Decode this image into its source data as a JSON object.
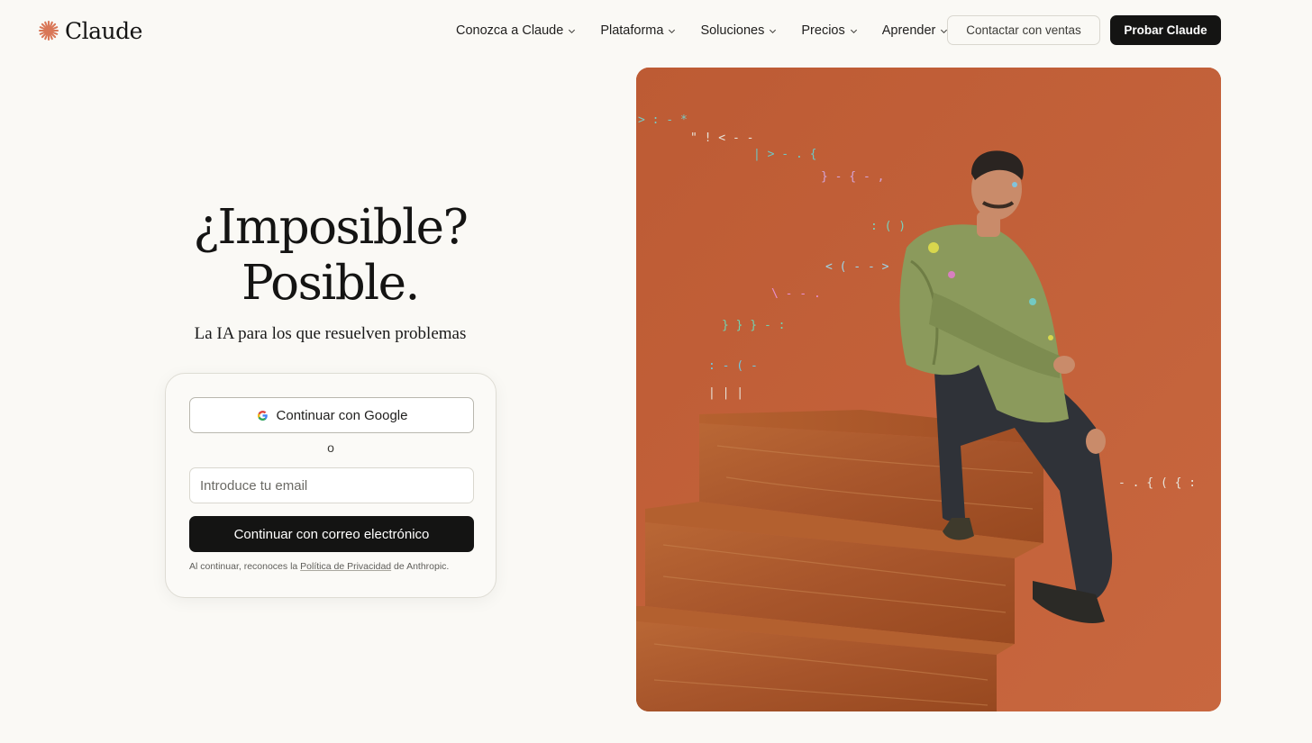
{
  "brand": {
    "name": "Claude",
    "accent_color": "#d97757"
  },
  "nav": {
    "items": [
      {
        "label": "Conozca a Claude"
      },
      {
        "label": "Plataforma"
      },
      {
        "label": "Soluciones"
      },
      {
        "label": "Precios"
      },
      {
        "label": "Aprender"
      }
    ],
    "contact_sales_label": "Contactar con ventas",
    "try_claude_label": "Probar Claude"
  },
  "hero": {
    "title_line1": "¿Imposible?",
    "title_line2": "Posible.",
    "subtitle": "La IA para los que resuelven problemas"
  },
  "login": {
    "google_button_label": "Continuar con Google",
    "or_text": "o",
    "email_placeholder": "Introduce tu email",
    "email_value": "",
    "email_button_label": "Continuar con correo electrónico",
    "legal_prefix": "Al continuar, reconoces la ",
    "legal_link": "Política de Privacidad",
    "legal_suffix": " de Anthropic."
  },
  "colors": {
    "background": "#faf9f5",
    "dark_button": "#141413",
    "image_backdrop": "#c0623a",
    "wood": "#a3502a"
  }
}
